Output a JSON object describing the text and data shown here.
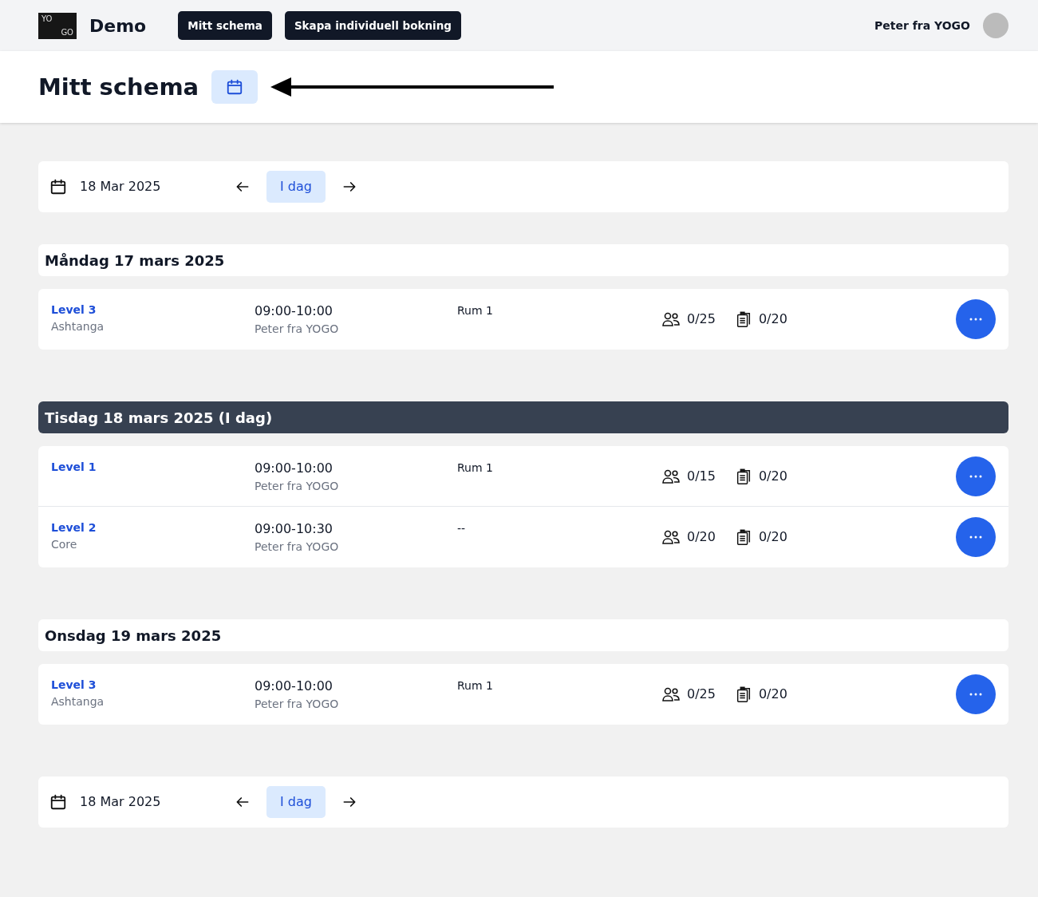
{
  "navbar": {
    "logo_top": "YO",
    "logo_bottom": "GO",
    "brand": "Demo",
    "buttons": [
      {
        "label": "Mitt schema"
      },
      {
        "label": "Skapa individuell bokning"
      }
    ],
    "user_name": "Peter fra YOGO"
  },
  "page_title": "Mitt schema",
  "date_nav_top": {
    "date": "18 Mar 2025",
    "today_label": "I dag"
  },
  "days": [
    {
      "title": "Måndag 17 mars 2025",
      "today": false,
      "classes": [
        {
          "name": "Level 3",
          "style": "Ashtanga",
          "time": "09:00-10:00",
          "teacher": "Peter fra YOGO",
          "room": "Rum 1",
          "signups": "0/25",
          "waitlist": "0/20"
        }
      ]
    },
    {
      "title": "Tisdag 18 mars 2025 (I dag)",
      "today": true,
      "classes": [
        {
          "name": "Level 1",
          "time": "09:00-10:00",
          "teacher": "Peter fra YOGO",
          "room": "Rum 1",
          "signups": "0/15",
          "waitlist": "0/20"
        },
        {
          "name": "Level 2",
          "style": "Core",
          "time": "09:00-10:30",
          "teacher": "Peter fra YOGO",
          "room": "--",
          "signups": "0/20",
          "waitlist": "0/20"
        }
      ]
    },
    {
      "title": "Onsdag 19 mars 2025",
      "today": false,
      "classes": [
        {
          "name": "Level 3",
          "style": "Ashtanga",
          "time": "09:00-10:00",
          "teacher": "Peter fra YOGO",
          "room": "Rum 1",
          "signups": "0/25",
          "waitlist": "0/20"
        }
      ]
    }
  ],
  "date_nav_bottom": {
    "date": "18 Mar 2025",
    "today_label": "I dag"
  }
}
